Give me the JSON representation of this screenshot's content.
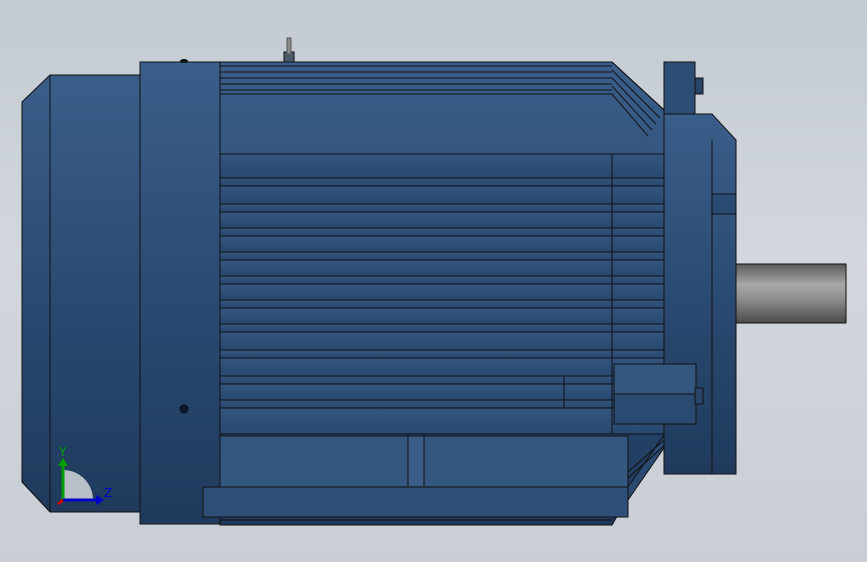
{
  "viewport": {
    "background": "#cbd0d7",
    "model": {
      "body_color": "#2d4a6e",
      "shaft_color": "#8a8a8a",
      "edge_color": "#111111"
    },
    "triad": {
      "x_label": "",
      "y_label": "Y",
      "z_label": "Z",
      "y_color": "#00a000",
      "z_color": "#0000c8",
      "x_color": "#c80000"
    }
  }
}
